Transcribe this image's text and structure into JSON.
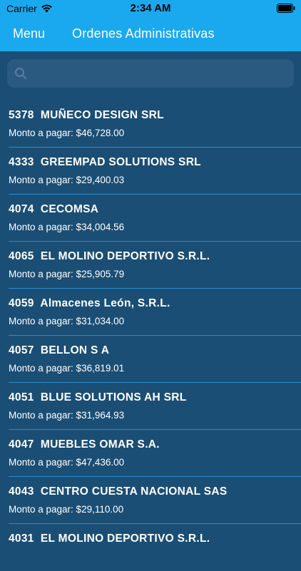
{
  "status_bar": {
    "carrier": "Carrier",
    "time": "2:34 AM",
    "icons": [
      "wifi-icon",
      "battery-icon"
    ]
  },
  "nav_bar": {
    "menu_label": "Menu",
    "title": "Ordenes Administrativas",
    "color": "#1aa9ee"
  },
  "search": {
    "placeholder": "",
    "value": ""
  },
  "orders": [
    {
      "id": "5378",
      "name": "MUÑECO DESIGN SRL",
      "amount_label": "Monto a pagar: $46,728.00"
    },
    {
      "id": "4333",
      "name": "GREEMPAD SOLUTIONS SRL",
      "amount_label": "Monto a pagar: $29,400.03"
    },
    {
      "id": "4074",
      "name": "CECOMSA",
      "amount_label": "Monto a pagar: $34,004.56"
    },
    {
      "id": "4065",
      "name": "EL MOLINO DEPORTIVO S.R.L.",
      "amount_label": "Monto a pagar: $25,905.79"
    },
    {
      "id": "4059",
      "name": "Almacenes León, S.R.L.",
      "amount_label": "Monto a pagar: $31,034.00"
    },
    {
      "id": "4057",
      "name": "BELLON S A",
      "amount_label": "Monto a pagar: $36,819.01"
    },
    {
      "id": "4051",
      "name": "BLUE SOLUTIONS AH SRL",
      "amount_label": "Monto a pagar: $31,964.93"
    },
    {
      "id": "4047",
      "name": "MUEBLES OMAR S.A.",
      "amount_label": "Monto a pagar: $47,436.00"
    },
    {
      "id": "4043",
      "name": "CENTRO CUESTA NACIONAL SAS",
      "amount_label": "Monto a pagar: $29,110.00"
    },
    {
      "id": "4031",
      "name": "EL MOLINO DEPORTIVO S.R.L.",
      "amount_label": ""
    }
  ],
  "colors": {
    "background": "#1b4e74",
    "divider": "#2a8ccc",
    "text": "#ffffff"
  }
}
